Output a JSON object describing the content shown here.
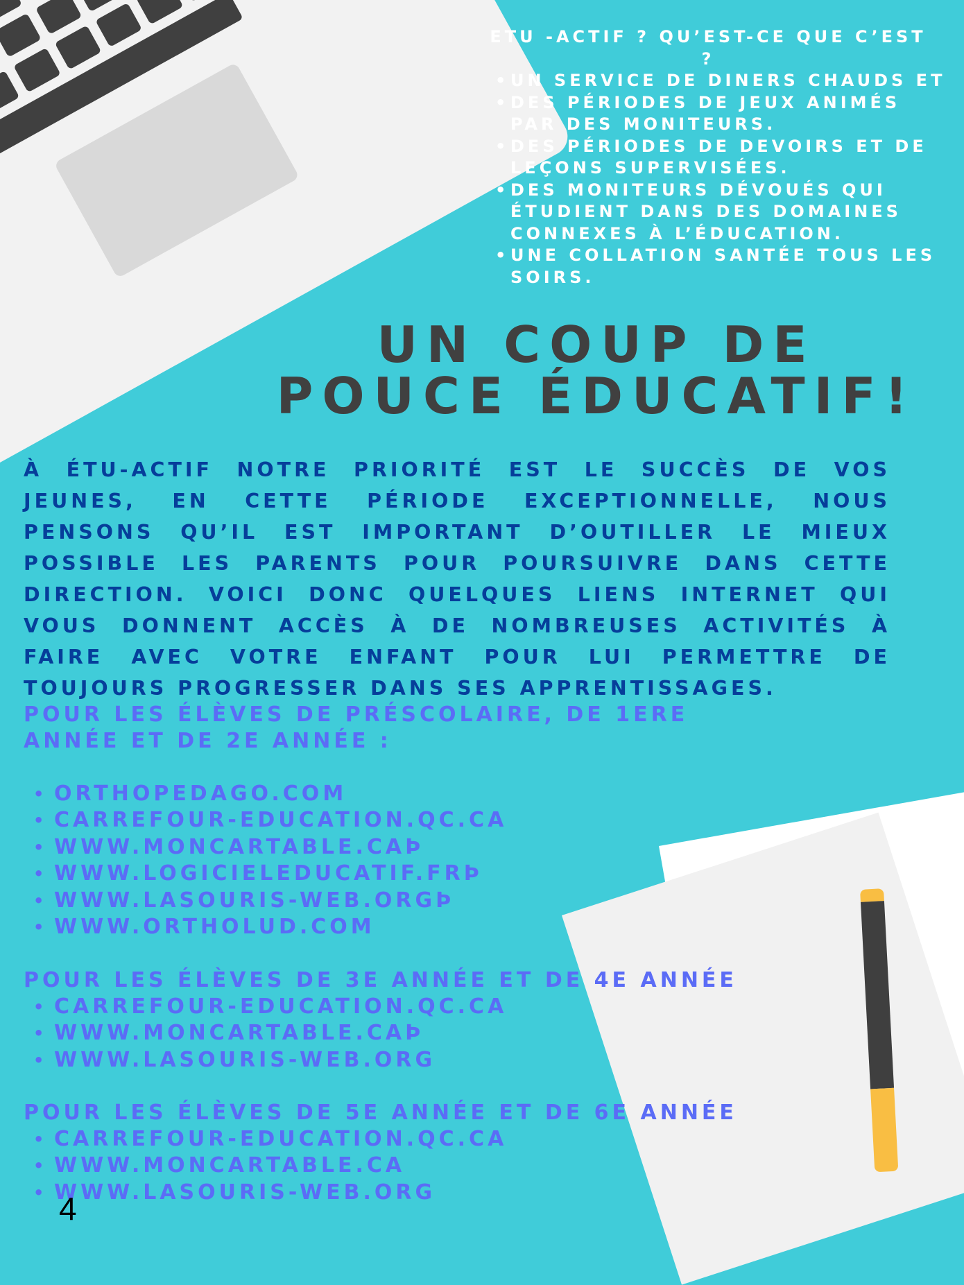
{
  "info": {
    "title": "ETU -ACTIF ? QU’EST-CE QUE C’EST ?",
    "items": [
      "UN SERVICE DE DINERS CHAUDS ET",
      "DES PÉRIODES DE JEUX ANIMÉS PAR DES MONITEURS.",
      "DES PÉRIODES DE DEVOIRS ET DE LEÇONS SUPERVISÉES.",
      "DES MONITEURS DÉVOUÉS QUI ÉTUDIENT DANS DES DOMAINES CONNEXES À L’ÉDUCATION.",
      "UNE COLLATION SANTÉE TOUS LES SOIRS."
    ]
  },
  "headline": "UN COUP DE POUCE ÉDUCATIF!",
  "intro": "À ÉTU-ACTIF NOTRE PRIORITÉ EST LE SUCCÈS DE VOS JEUNES, EN CETTE PÉRIODE EXCEPTIONNELLE, NOUS PENSONS QU’IL EST IMPORTANT D’OUTILLER LE MIEUX POSSIBLE LES PARENTS POUR POURSUIVRE DANS CETTE DIRECTION. VOICI DONC QUELQUES LIENS INTERNET QUI VOUS DONNENT ACCÈS À DE NOMBREUSES ACTIVITÉS À FAIRE AVEC VOTRE ENFANT POUR LUI PERMETTRE DE TOUJOURS PROGRESSER DANS SES APPRENTISSAGES.",
  "sections": [
    {
      "heading": "POUR LES ÉLÈVES DE PRÉSCOLAIRE, DE 1ERE ANNÉE ET DE 2E ANNÉE :",
      "links": [
        "ORTHOPEDAGO.COM",
        "CARREFOUR-EDUCATION.QC.CA",
        "WWW.MONCARTABLE.CAÞ",
        "WWW.LOGICIELEDUCATIF.FRÞ",
        "WWW.LASOURIS-WEB.ORGÞ",
        "WWW.ORTHOLUD.COM"
      ]
    },
    {
      "heading": "POUR LES ÉLÈVES DE 3E ANNÉE ET DE 4E ANNÉE",
      "links": [
        "CARREFOUR-EDUCATION.QC.CA",
        "WWW.MONCARTABLE.CAÞ",
        "WWW.LASOURIS-WEB.ORG"
      ]
    },
    {
      "heading": "POUR LES ÉLÈVES DE 5E ANNÉE ET DE 6E ANNÉE",
      "links": [
        "CARREFOUR-EDUCATION.QC.CA",
        "WWW.MONCARTABLE.CA",
        "WWW.LASOURIS-WEB.ORG"
      ]
    }
  ],
  "page_number": "4",
  "colors": {
    "background": "#40CCD9",
    "headline": "#404040",
    "intro": "#063E9A",
    "links": "#5B6CF6"
  }
}
